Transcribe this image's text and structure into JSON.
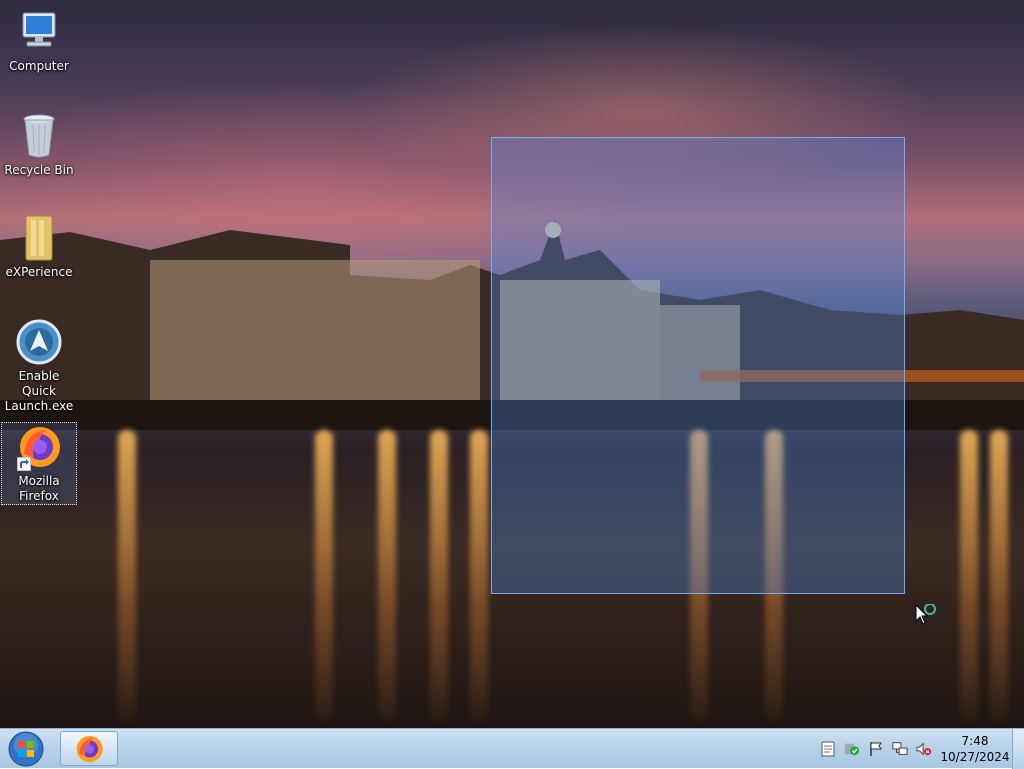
{
  "desktop": {
    "icons": [
      {
        "label": "Computer",
        "icon": "computer-icon"
      },
      {
        "label": "Recycle Bin",
        "icon": "recycle-bin-icon"
      },
      {
        "label": "eXPerience",
        "icon": "folder-icon"
      },
      {
        "label": "Enable Quick Launch.exe",
        "icon": "quick-launch-app-icon"
      },
      {
        "label": "Mozilla Firefox",
        "icon": "firefox-icon"
      }
    ]
  },
  "taskbar": {
    "start_icon": "windows-start-orb-icon",
    "pinned": [
      {
        "icon": "firefox-icon"
      }
    ],
    "tray_icons": [
      "notes-icon",
      "security-shield-icon",
      "action-center-flag-icon",
      "network-icon",
      "volume-muted-icon"
    ],
    "clock": {
      "time": "7:48",
      "date": "10/27/2024"
    }
  },
  "colors": {
    "selection": "#508ce6",
    "taskbar_top": "#cfe1f2",
    "taskbar_bottom": "#a9c6e3"
  }
}
